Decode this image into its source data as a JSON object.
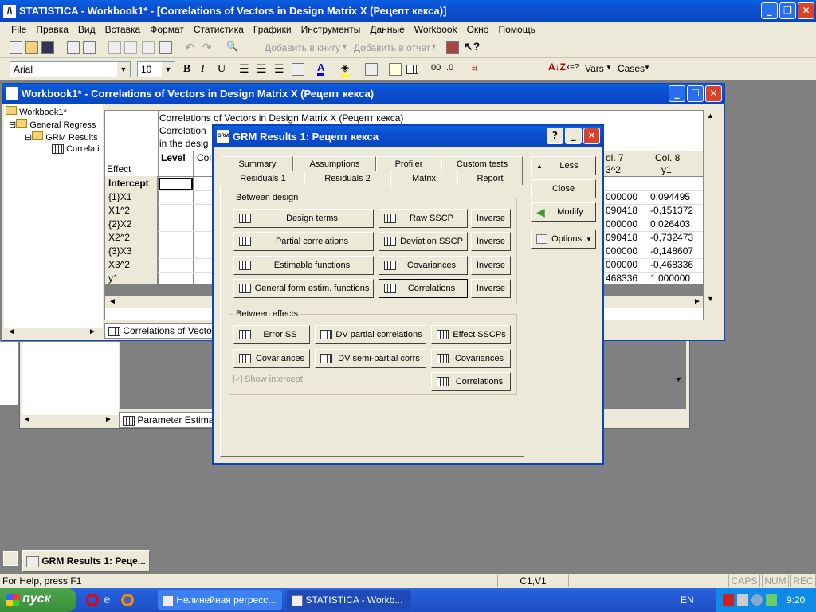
{
  "app": {
    "title": "STATISTICA - Workbook1* - [Correlations of Vectors in Design Matrix X (Рецепт кекса)]"
  },
  "menu": [
    "File",
    "Правка",
    "Вид",
    "Вставка",
    "Формат",
    "Статистика",
    "Графики",
    "Инструменты",
    "Данные",
    "Workbook",
    "Окно",
    "Помощь"
  ],
  "toolbar": {
    "add_to_book": "Добавить в книгу",
    "add_to_report": "Добавить в отчет",
    "font": "Arial",
    "font_size": "10",
    "vars": "Vars",
    "cases": "Cases"
  },
  "workbook": {
    "title": "Workbook1* - Correlations of Vectors in Design Matrix X (Рецепт кекса)",
    "tree": [
      "Workbook1*",
      "General Regress",
      "GRM Results",
      "Correlati"
    ],
    "bottom_tab": "Correlations of Vectors i",
    "bottom_tab2": "Parameter Estimate"
  },
  "sheet": {
    "header_lines": [
      "Correlations of Vectors in Design Matrix X (Рецепт кекса)",
      "Correlation",
      "in the desig"
    ],
    "effect_label": "Effect",
    "level_label": "Level",
    "col_label": "Col",
    "col7": "ol. 7",
    "col7b": "3^2",
    "col8": "Col. 8",
    "col8b": "y1",
    "rows": [
      {
        "label": "Intercept",
        "c7": "",
        "c8": ""
      },
      {
        "label": "{1}X1",
        "c7": "000000",
        "c8": "0,094495"
      },
      {
        "label": "X1^2",
        "c7": "090418",
        "c8": "-0,151372"
      },
      {
        "label": "{2}X2",
        "c7": "000000",
        "c8": "0,026403"
      },
      {
        "label": "X2^2",
        "c7": "090418",
        "c8": "-0,732473"
      },
      {
        "label": "{3}X3",
        "c7": "000000",
        "c8": "-0,148607"
      },
      {
        "label": "X3^2",
        "c7": "000000",
        "c8": "-0,468336"
      },
      {
        "label": "y1",
        "c7": "468336",
        "c8": "1,000000"
      }
    ]
  },
  "dialog": {
    "title": "GRM Results 1: Рецепт кекса",
    "tabs_back": [
      "Summary",
      "Assumptions",
      "Profiler",
      "Custom tests"
    ],
    "tabs_front": [
      "Residuals 1",
      "Residuals 2",
      "Matrix",
      "Report"
    ],
    "group1": "Between design",
    "group2": "Between effects",
    "design_terms": "Design terms",
    "raw_sscp": "Raw SSCP",
    "inverse": "Inverse",
    "partial_corr": "Partial correlations",
    "dev_sscp": "Deviation SSCP",
    "estimable": "Estimable functions",
    "covariances": "Covariances",
    "gen_form": "General form estim. functions",
    "correlations": "Correlations",
    "error_ss": "Error SS",
    "dv_partial": "DV partial correlations",
    "effect_sscp": "Effect SSCPs",
    "dv_semi": "DV semi-partial corrs",
    "show_intercept": "Show intercept",
    "less": "Less",
    "close": "Close",
    "modify": "Modify",
    "options": "Options"
  },
  "status": {
    "help": "For Help, press F1",
    "cell": "C1,V1",
    "caps": "CAPS",
    "num": "NUM",
    "rec": "REC"
  },
  "minimized": "GRM Results 1: Реце...",
  "taskbar": {
    "start": "пуск",
    "task1": "Нелинейная регресс...",
    "task2": "STATISTICA - Workb...",
    "lang": "EN",
    "clock": "9:20"
  },
  "colors": {
    "xp_blue": "#0b4fd0",
    "face": "#ece9d8",
    "green": "#3a9a2a"
  }
}
